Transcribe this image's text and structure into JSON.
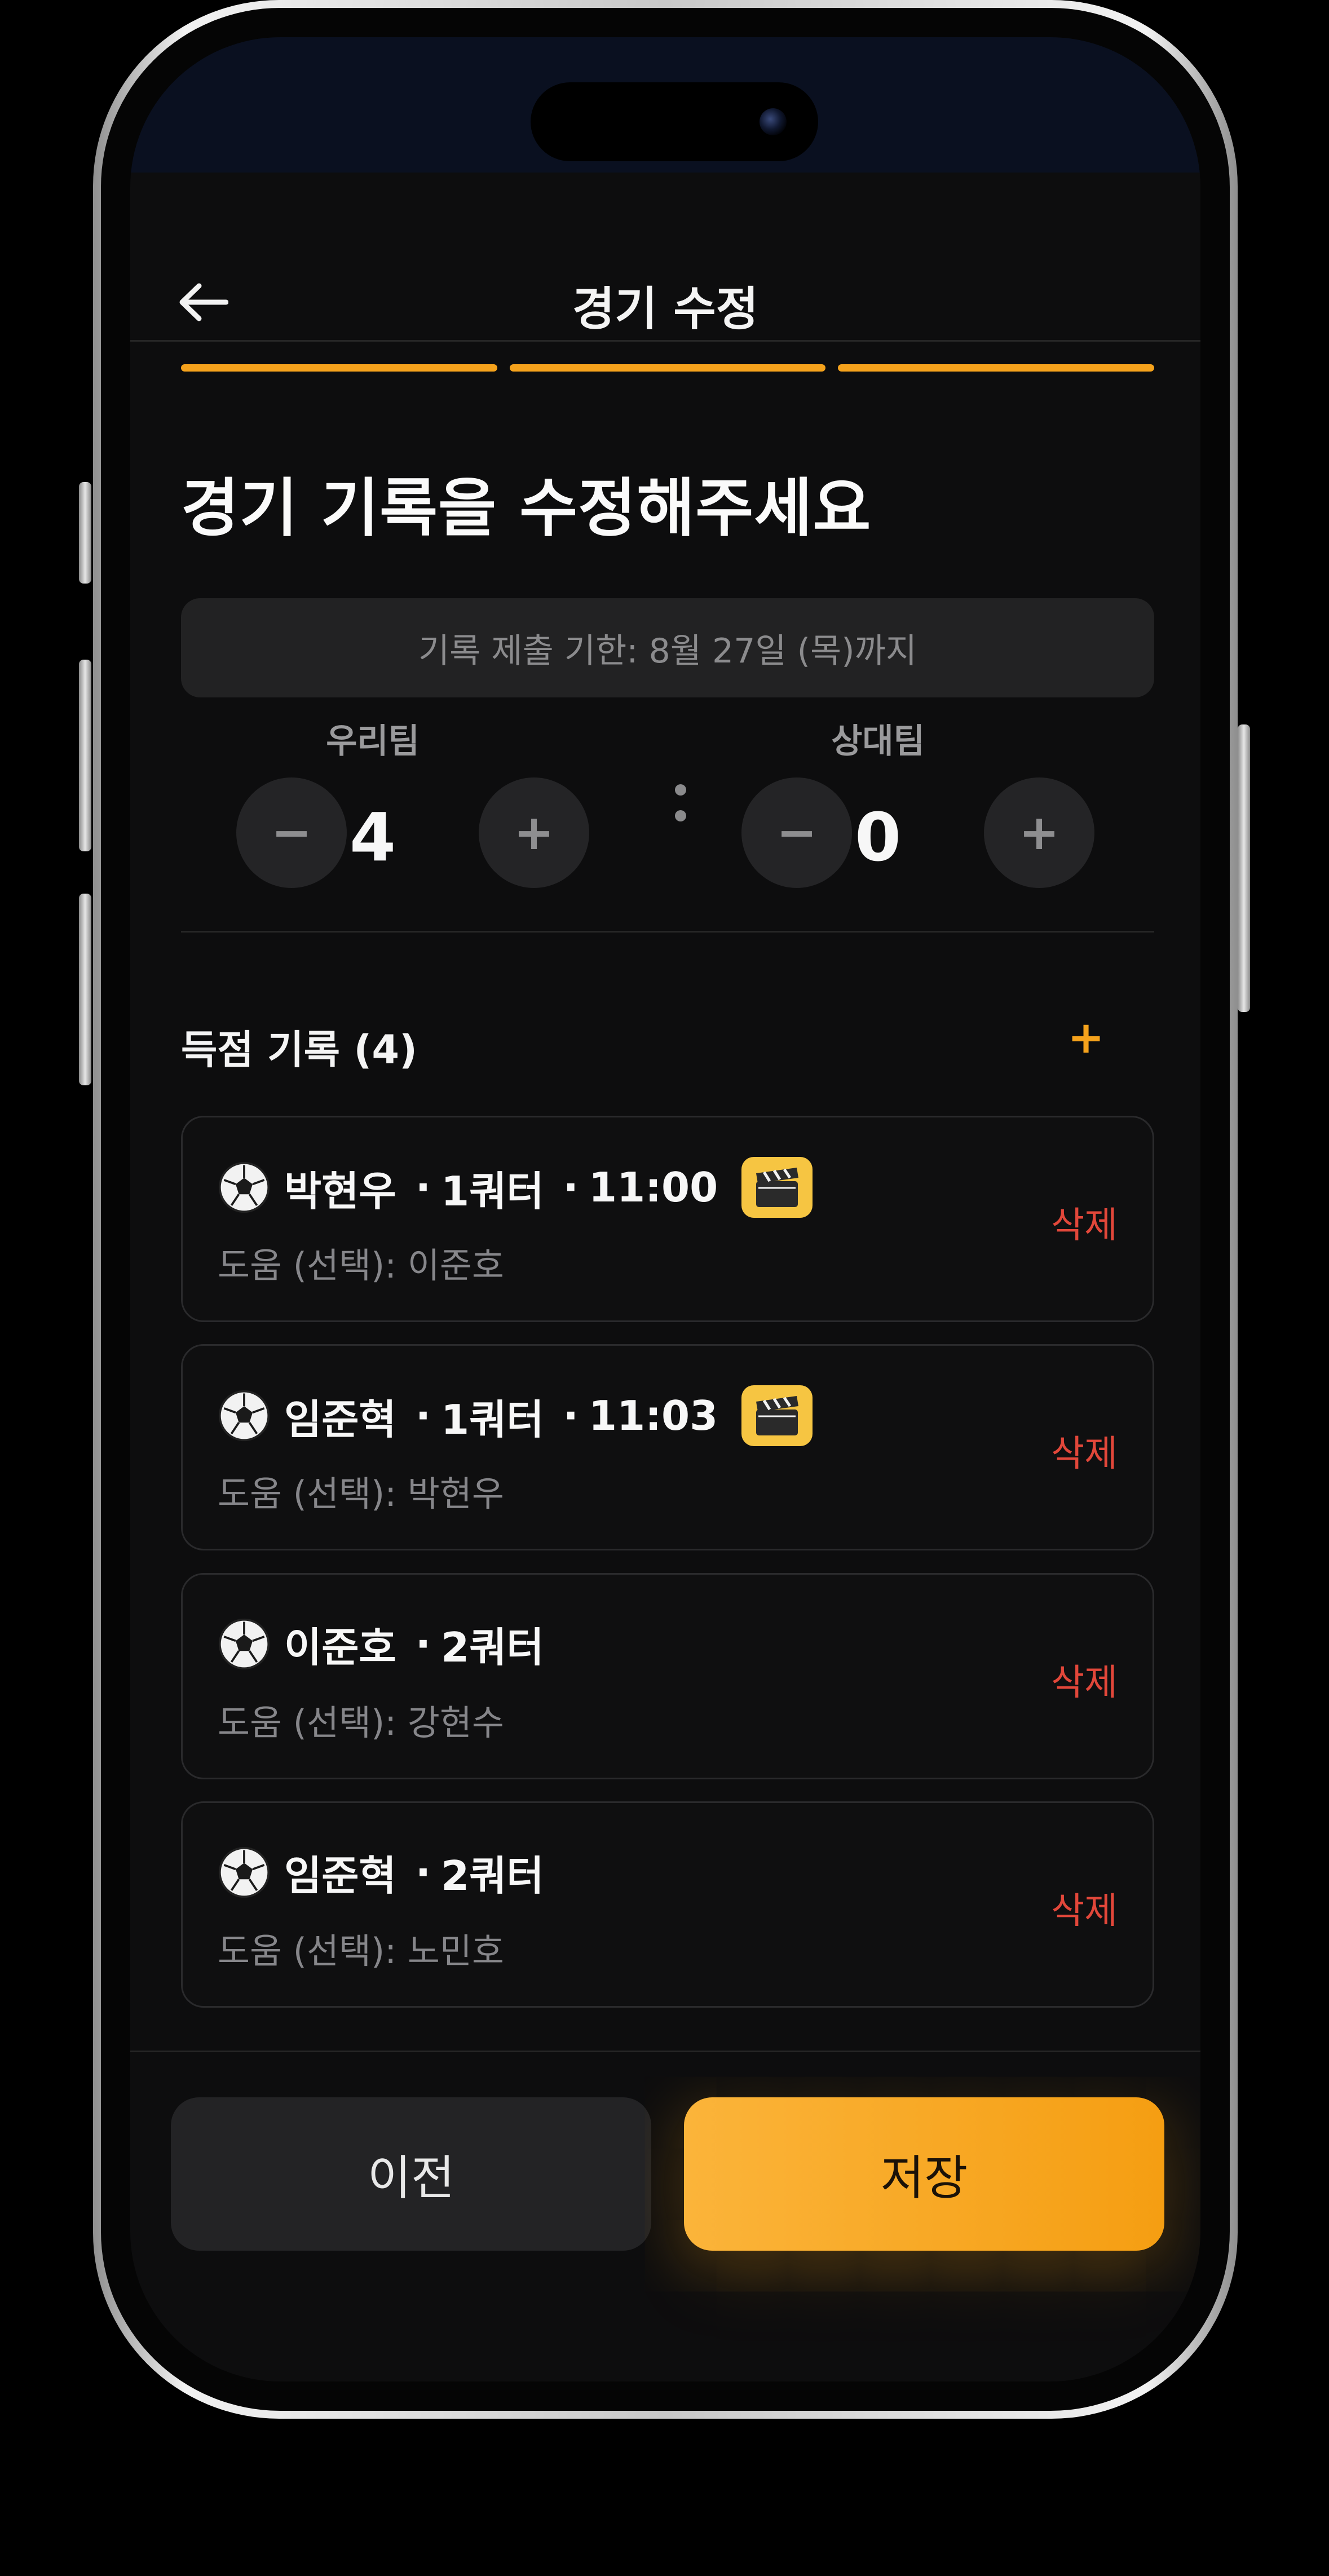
{
  "header": {
    "title": "경기 수정",
    "back_icon": "arrow-left-icon"
  },
  "progress": {
    "steps_total": 3,
    "steps_done": 3,
    "color": "#f5a21c"
  },
  "headline": "경기 기록을 수정해주세요",
  "deadline": "기록 제출 기한: 8월 27일 (목)까지",
  "score": {
    "home": {
      "label": "우리팀",
      "value": "4",
      "minus": "−",
      "plus": "+"
    },
    "away": {
      "label": "상대팀",
      "value": "0",
      "minus": "−",
      "plus": "+"
    }
  },
  "goals_section": {
    "title": "득점 기록 (4)",
    "add_label": "+"
  },
  "goals": [
    {
      "player": "박현우",
      "quarter": "1쿼터",
      "time": "11:00",
      "has_video": true,
      "assist_label": "도움 (선택): ",
      "assist": "이준호",
      "delete": "삭제"
    },
    {
      "player": "임준혁",
      "quarter": "1쿼터",
      "time": "11:03",
      "has_video": true,
      "assist_label": "도움 (선택): ",
      "assist": "박현우",
      "delete": "삭제"
    },
    {
      "player": "이준호",
      "quarter": "2쿼터",
      "time": "",
      "has_video": false,
      "assist_label": "도움 (선택): ",
      "assist": "강현수",
      "delete": "삭제"
    },
    {
      "player": "임준혁",
      "quarter": "2쿼터",
      "time": "",
      "has_video": false,
      "assist_label": "도움 (선택): ",
      "assist": "노민호",
      "delete": "삭제"
    }
  ],
  "separator": "·",
  "buttons": {
    "prev": "이전",
    "save": "저장"
  },
  "colors": {
    "accent": "#f5a21c",
    "danger": "#e2473a",
    "background": "#0d0d0e"
  }
}
